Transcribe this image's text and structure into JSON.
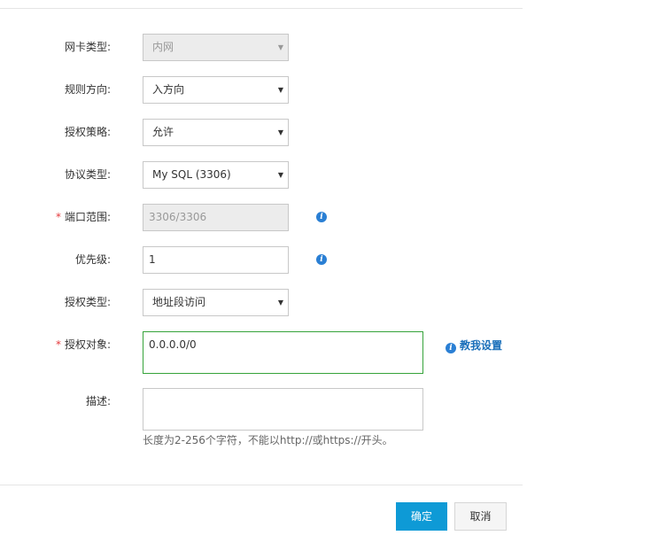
{
  "form": {
    "nic_type": {
      "label": "网卡类型:",
      "value": "内网",
      "disabled": true
    },
    "rule_direction": {
      "label": "规则方向:",
      "value": "入方向"
    },
    "auth_policy": {
      "label": "授权策略:",
      "value": "允许"
    },
    "protocol_type": {
      "label": "协议类型:",
      "value": "My SQL (3306)"
    },
    "port_range": {
      "label": "端口范围:",
      "value": "3306/3306",
      "required": true,
      "disabled": true
    },
    "priority": {
      "label": "优先级:",
      "value": "1"
    },
    "auth_type": {
      "label": "授权类型:",
      "value": "地址段访问"
    },
    "auth_object": {
      "label": "授权对象:",
      "value": "0.0.0.0/0",
      "required": true,
      "help_link": "教我设置"
    },
    "description": {
      "label": "描述:",
      "value": "",
      "hint": "长度为2-256个字符，不能以http://或https://开头。"
    }
  },
  "footer": {
    "confirm_label": "确定",
    "cancel_label": "取消"
  },
  "icons": {
    "info": "info-icon",
    "dropdown": "caret-down-icon",
    "required_marker": "*"
  },
  "colors": {
    "primary_button": "#0e9ad6",
    "required": "#e4393c",
    "link": "#1a6fba",
    "focus_border": "#36a33a",
    "info_icon": "#2a7fd4"
  }
}
